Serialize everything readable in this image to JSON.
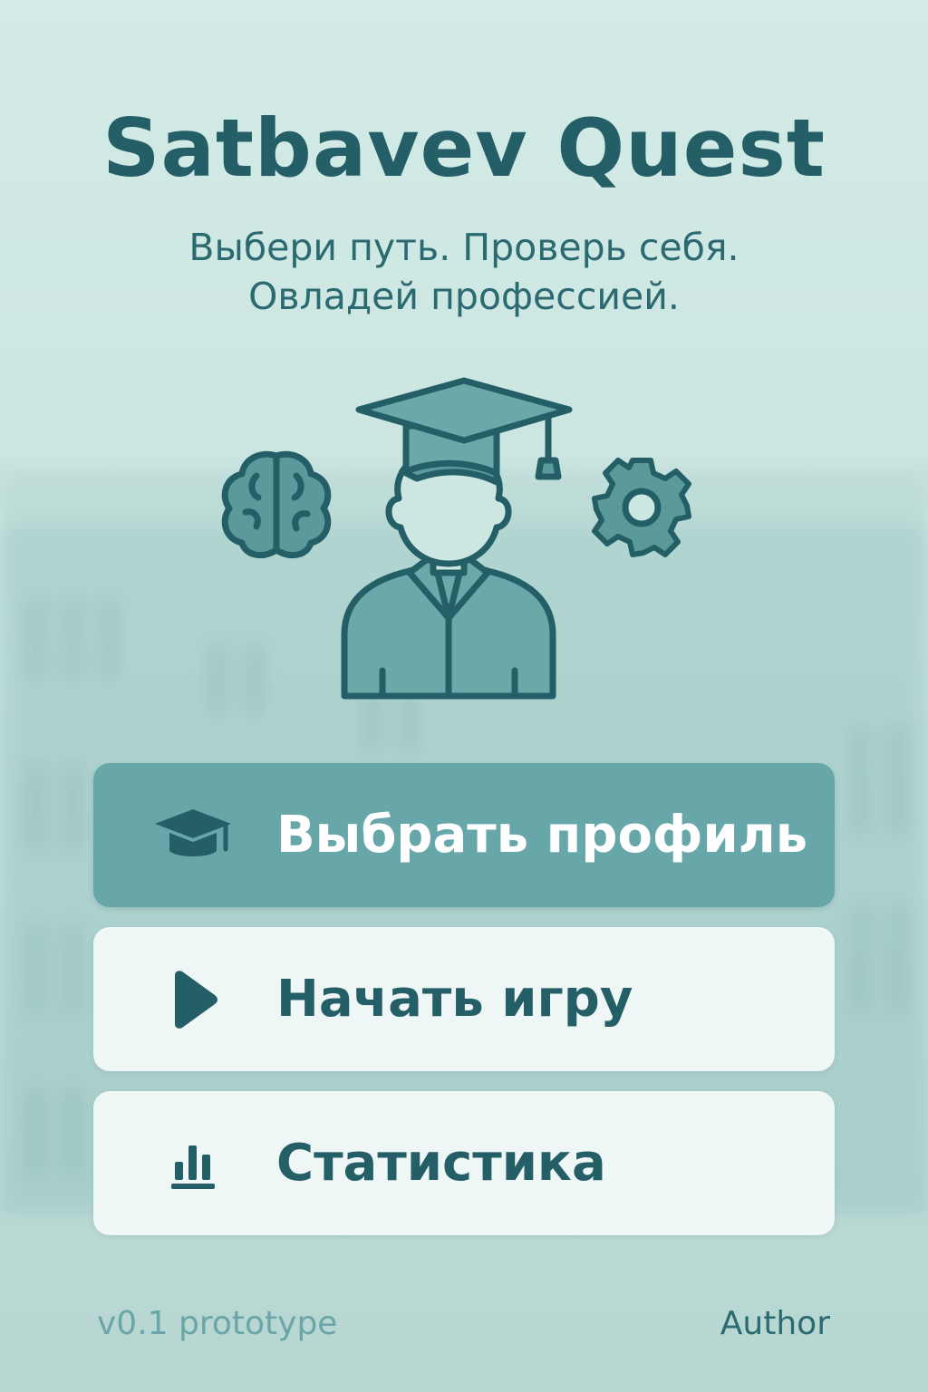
{
  "app": {
    "title": "Satbavev Quest",
    "subtitle_line1": "Выбери путь. Проверь себя.",
    "subtitle_line2": "Овладей профессией."
  },
  "hero": {
    "icons": [
      "brain-icon",
      "student-graduate-icon",
      "gear-icon"
    ]
  },
  "menu": {
    "items": [
      {
        "label": "Выбрать профиль",
        "icon": "graduation-cap-icon",
        "active": true
      },
      {
        "label": "Начать игру",
        "icon": "play-icon",
        "active": false
      },
      {
        "label": "Статистика",
        "icon": "bar-chart-icon",
        "active": false
      }
    ]
  },
  "footer": {
    "version": "v0.1 prototype",
    "author": "Author"
  },
  "colors": {
    "primary": "#245e66",
    "accent": "#67a7a9",
    "background": "#cce6e2",
    "button_light": "#eef6f6"
  }
}
